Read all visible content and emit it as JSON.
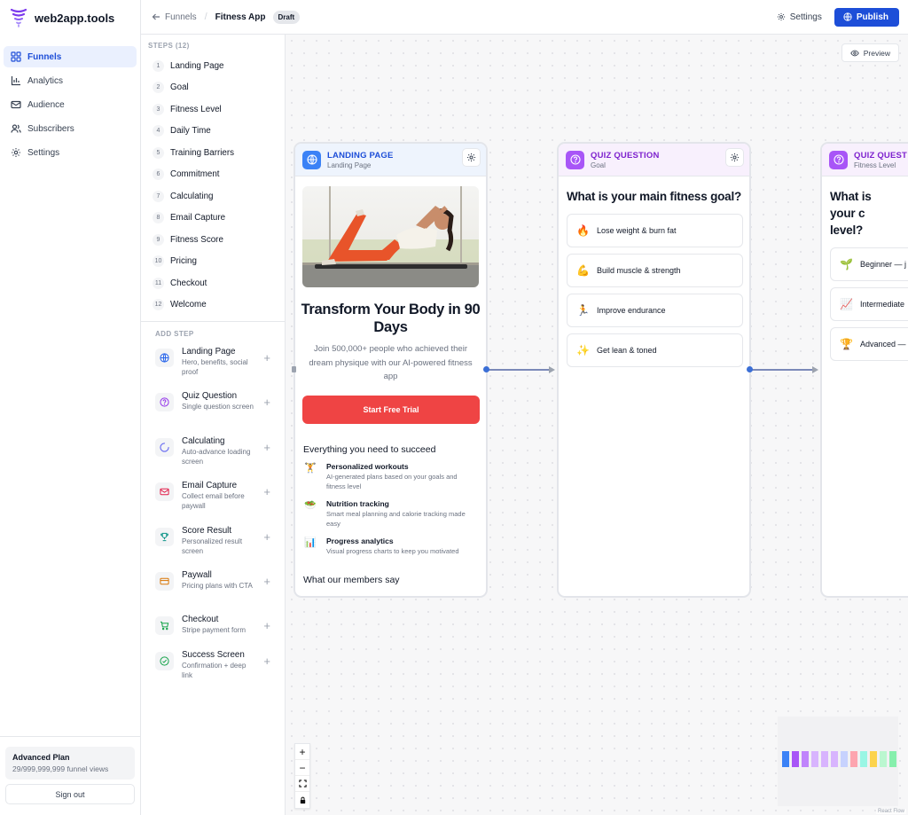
{
  "brand": {
    "name": "web2app.tools"
  },
  "nav": {
    "items": [
      {
        "label": "Funnels"
      },
      {
        "label": "Analytics"
      },
      {
        "label": "Audience"
      },
      {
        "label": "Subscribers"
      },
      {
        "label": "Settings"
      }
    ],
    "active": "Funnels",
    "plan": {
      "title": "Advanced Plan",
      "views": "29/999,999,999 funnel views"
    },
    "signout_label": "Sign out"
  },
  "topbar": {
    "back_label": "Funnels",
    "current": "Fitness App",
    "badge": "Draft",
    "settings_label": "Settings",
    "publish_label": "Publish"
  },
  "steps": {
    "heading": "STEPS (12)",
    "items": [
      {
        "num": "1",
        "label": "Landing Page"
      },
      {
        "num": "2",
        "label": "Goal"
      },
      {
        "num": "3",
        "label": "Fitness Level"
      },
      {
        "num": "4",
        "label": "Daily Time"
      },
      {
        "num": "5",
        "label": "Training Barriers"
      },
      {
        "num": "6",
        "label": "Commitment"
      },
      {
        "num": "7",
        "label": "Calculating"
      },
      {
        "num": "8",
        "label": "Email Capture"
      },
      {
        "num": "9",
        "label": "Fitness Score"
      },
      {
        "num": "10",
        "label": "Pricing"
      },
      {
        "num": "11",
        "label": "Checkout"
      },
      {
        "num": "12",
        "label": "Welcome"
      }
    ]
  },
  "add_step": {
    "heading": "ADD STEP",
    "templates": [
      {
        "name": "Landing Page",
        "desc": "Hero, benefits, social proof",
        "icon": "globe-icon",
        "color": "#2563eb"
      },
      {
        "name": "Quiz Question",
        "desc": "Single question screen",
        "icon": "question-circle-icon",
        "color": "#9333ea"
      },
      {
        "name": "Calculating",
        "desc": "Auto-advance loading screen",
        "icon": "loader-icon",
        "color": "#6366f1"
      },
      {
        "name": "Email Capture",
        "desc": "Collect email before paywall",
        "icon": "mail-icon",
        "color": "#e11d48"
      },
      {
        "name": "Score Result",
        "desc": "Personalized result screen",
        "icon": "trophy-icon",
        "color": "#0d9488"
      },
      {
        "name": "Paywall",
        "desc": "Pricing plans with CTA",
        "icon": "credit-card-icon",
        "color": "#d97706"
      },
      {
        "name": "Checkout",
        "desc": "Stripe payment form",
        "icon": "cart-icon",
        "color": "#16a34a"
      },
      {
        "name": "Success Screen",
        "desc": "Confirmation + deep link",
        "icon": "check-circle-icon",
        "color": "#16a34a"
      }
    ]
  },
  "canvas": {
    "preview_label": "Preview",
    "attribution": "React Flow",
    "cards": {
      "landing": {
        "type": "LANDING PAGE",
        "sub": "Landing Page",
        "headline": "Transform Your Body in 90 Days",
        "subtext": "Join 500,000+ people who achieved their dream physique with our AI-powered fitness app",
        "cta": "Start Free Trial",
        "features_title": "Everything you need to succeed",
        "features": [
          {
            "emoji": "🏋️",
            "title": "Personalized workouts",
            "desc": "AI-generated plans based on your goals and fitness level"
          },
          {
            "emoji": "🥗",
            "title": "Nutrition tracking",
            "desc": "Smart meal planning and calorie tracking made easy"
          },
          {
            "emoji": "📊",
            "title": "Progress analytics",
            "desc": "Visual progress charts to keep you motivated"
          }
        ],
        "members_title": "What our members say"
      },
      "goal": {
        "type": "QUIZ QUESTION",
        "sub": "Goal",
        "question": "What is your main fitness goal?",
        "options": [
          {
            "emoji": "🔥",
            "label": "Lose weight & burn fat"
          },
          {
            "emoji": "💪",
            "label": "Build muscle & strength"
          },
          {
            "emoji": "🏃",
            "label": "Improve endurance"
          },
          {
            "emoji": "✨",
            "label": "Get lean & toned"
          }
        ]
      },
      "level": {
        "type": "QUIZ QUEST",
        "sub": "Fitness Level",
        "question": "What is your c level?",
        "options": [
          {
            "emoji": "🌱",
            "label": "Beginner — j"
          },
          {
            "emoji": "📈",
            "label": "Intermediate"
          },
          {
            "emoji": "🏆",
            "label": "Advanced —"
          }
        ]
      }
    },
    "controls": [
      "+",
      "−",
      "fit",
      "lock"
    ],
    "minimap_colors": [
      "#3b82f6",
      "#a855f7",
      "#c084fc",
      "#d8b4fe",
      "#d8b4fe",
      "#d8b4fe",
      "#c7d2fe",
      "#fda4af",
      "#99f6e4",
      "#fcd34d",
      "#bbf7d0",
      "#86efac"
    ]
  },
  "colors": {
    "accent": "#1d4ed8",
    "cta": "#ef4444",
    "nav_active_bg": "#eaf0fe"
  }
}
